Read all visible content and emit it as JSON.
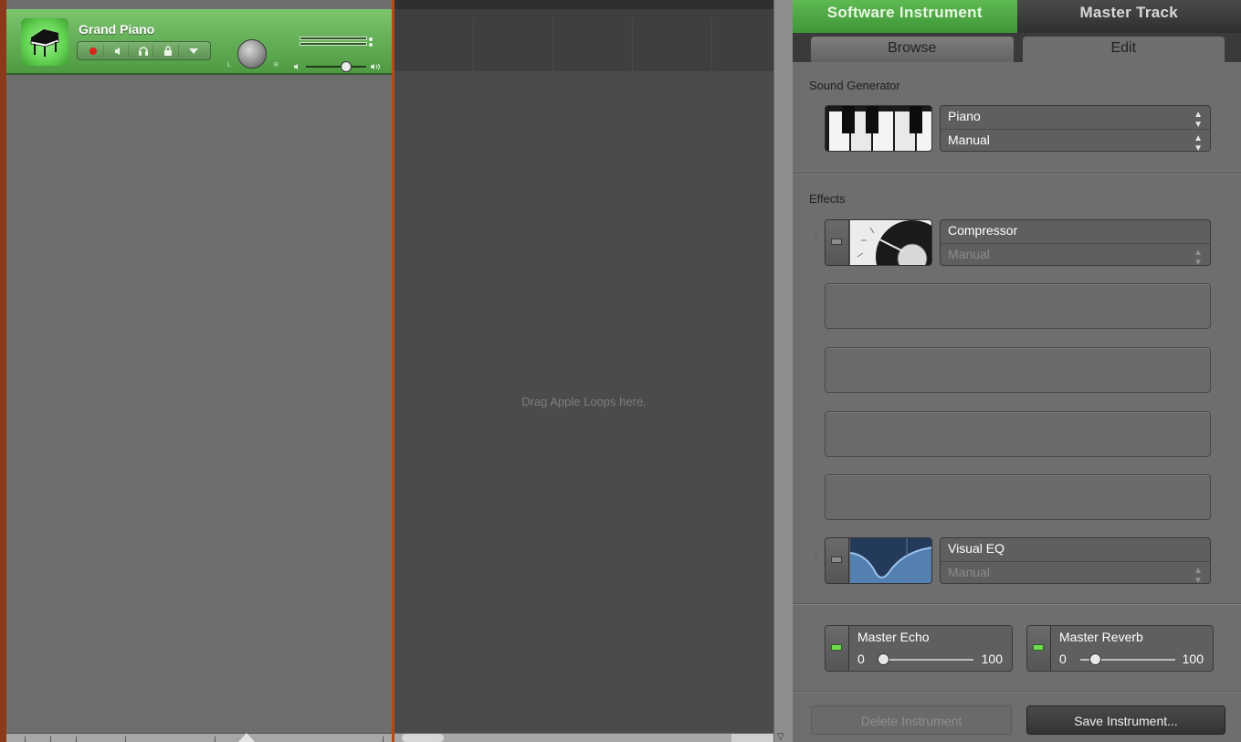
{
  "track": {
    "name": "Grand Piano",
    "pan_left": "L",
    "pan_right": "R"
  },
  "timeline": {
    "drop_hint": "Drag Apple Loops here."
  },
  "panel": {
    "top_tabs": [
      "Software Instrument",
      "Master Track"
    ],
    "sub_tabs": [
      "Browse",
      "Edit"
    ],
    "sound_generator": {
      "title": "Sound Generator",
      "instrument": "Piano",
      "preset": "Manual"
    },
    "effects": {
      "title": "Effects",
      "slot1": {
        "name": "Compressor",
        "preset": "Manual"
      },
      "slot2": {
        "name": "Visual EQ",
        "preset": "Manual"
      }
    },
    "master_echo": {
      "label": "Master Echo",
      "min": "0",
      "max": "100",
      "value": 5
    },
    "master_reverb": {
      "label": "Master Reverb",
      "min": "0",
      "max": "100",
      "value": 15
    },
    "buttons": {
      "delete": "Delete Instrument",
      "save": "Save Instrument..."
    }
  }
}
